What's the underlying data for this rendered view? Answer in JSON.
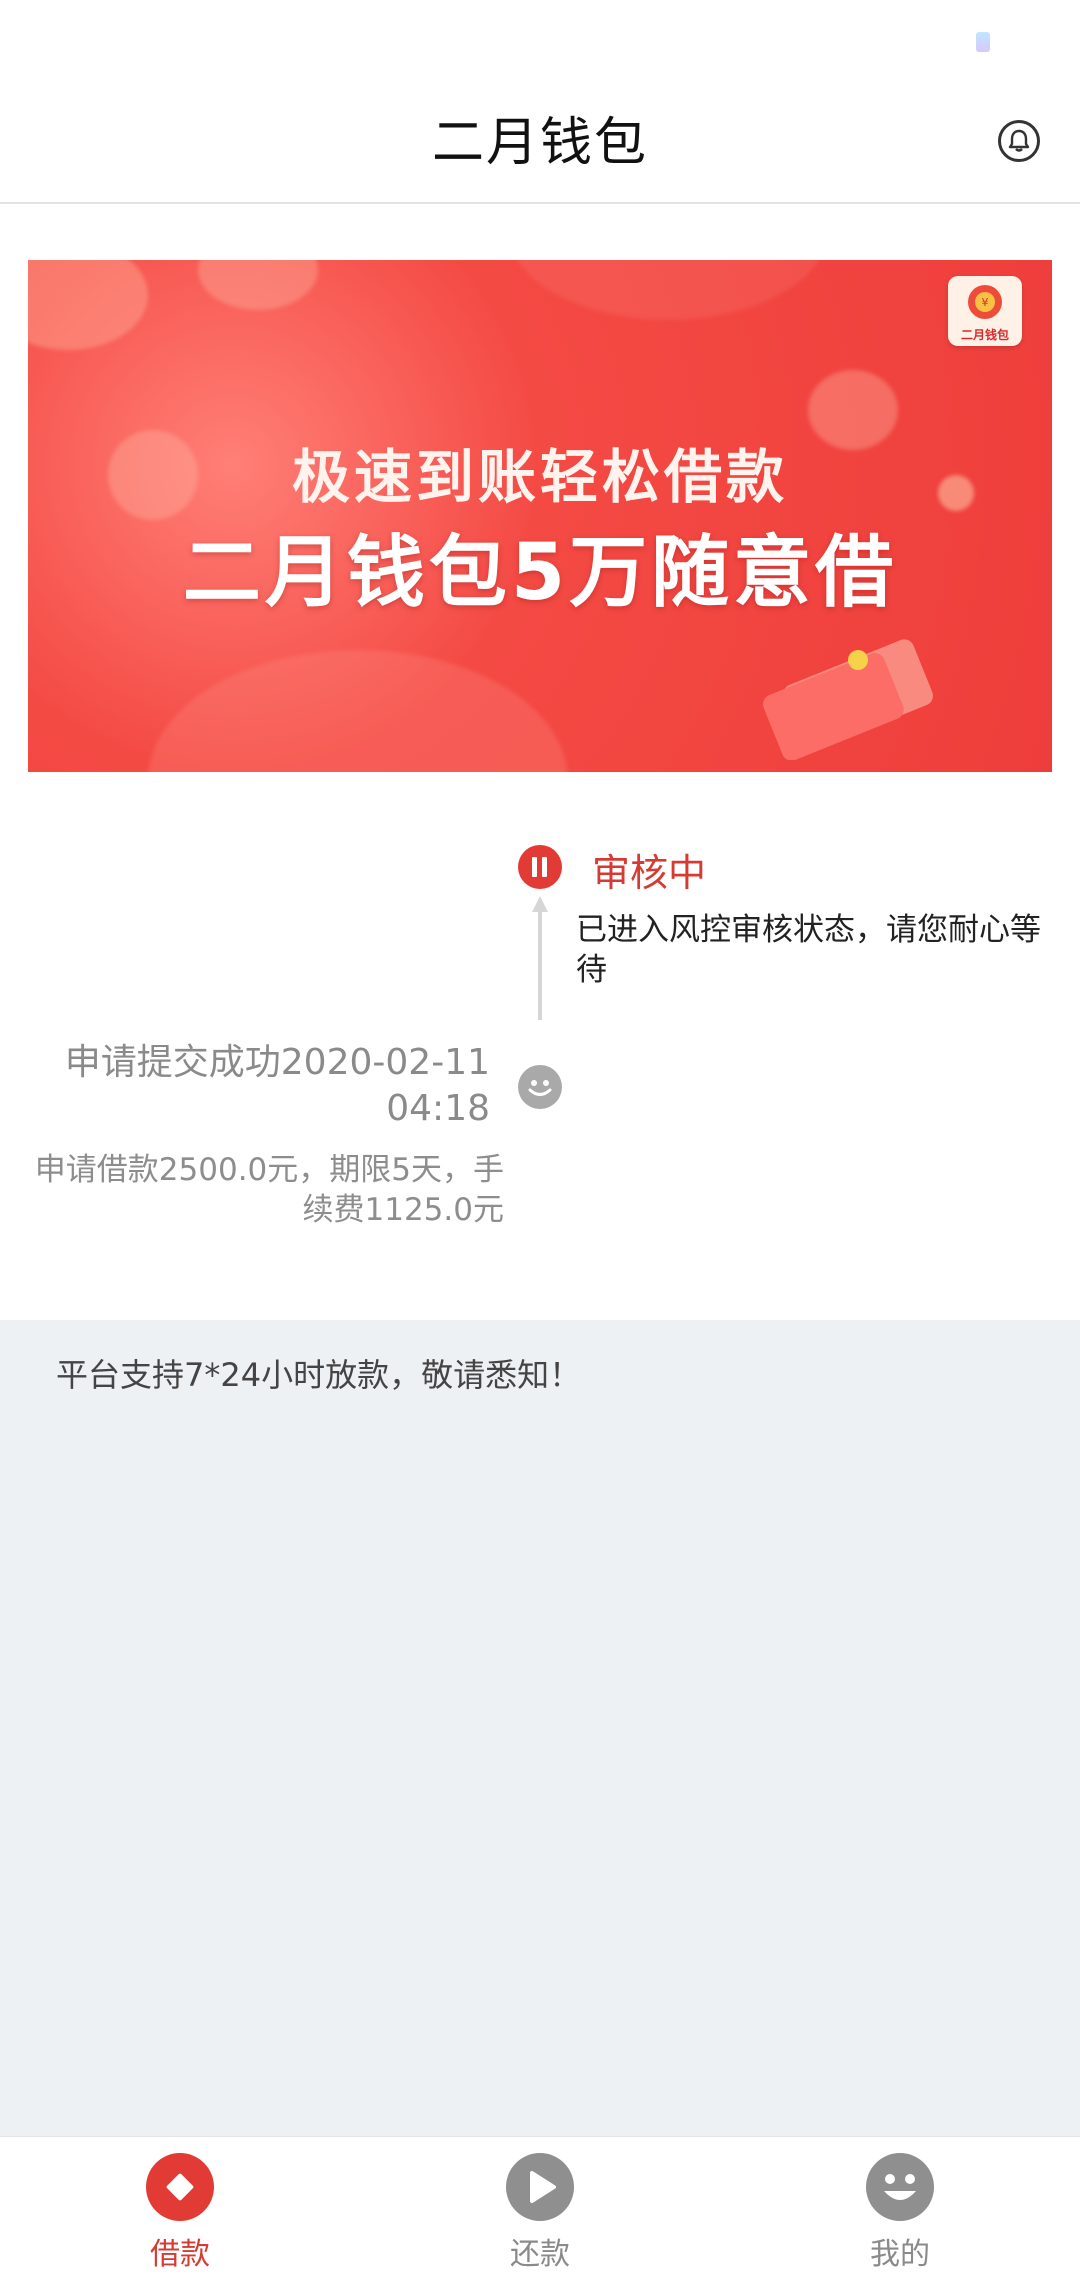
{
  "header": {
    "title": "二月钱包",
    "bell_icon": "bell-icon"
  },
  "banner": {
    "line1": "极速到账轻松借款",
    "line2": "二月钱包5万随意借",
    "logo_text": "二月钱包"
  },
  "timeline": {
    "current": {
      "status": "审核中",
      "description": "已进入风控审核状态，请您耐心等待",
      "icon": "pause-icon"
    },
    "submitted": {
      "title": "申请提交成功2020-02-11 04:18",
      "detail": "申请借款2500.0元，期限5天，手续费1125.0元",
      "icon": "smile-icon"
    }
  },
  "notice": {
    "text": "平台支持7*24小时放款，敬请悉知！"
  },
  "tabbar": {
    "items": [
      {
        "label": "借款",
        "icon": "diamond-icon",
        "active": true
      },
      {
        "label": "还款",
        "icon": "play-icon",
        "active": false
      },
      {
        "label": "我的",
        "icon": "smiley-icon",
        "active": false
      }
    ]
  },
  "colors": {
    "accent": "#e23a34",
    "inactive": "#8f8f8f",
    "background": "#eef1f4"
  }
}
